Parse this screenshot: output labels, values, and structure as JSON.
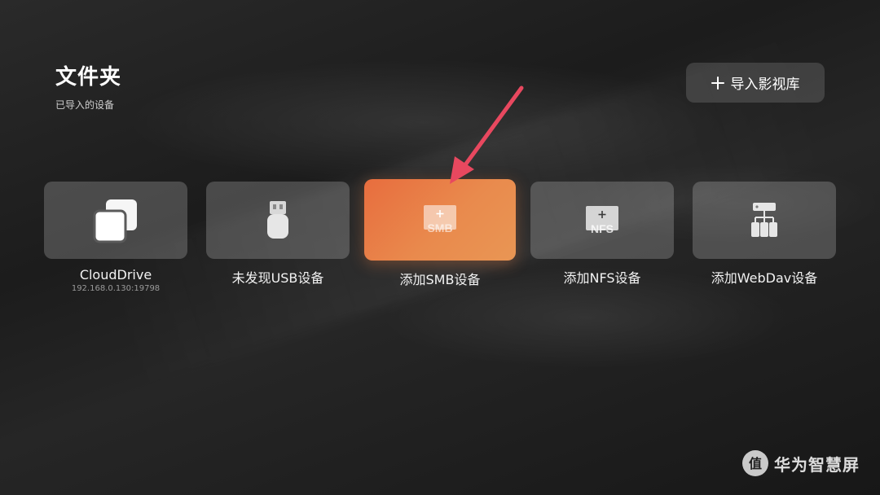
{
  "header": {
    "title": "文件夹",
    "subtitle": "已导入的设备"
  },
  "toolbar": {
    "import_label": "导入影视库"
  },
  "devices": [
    {
      "label": "CloudDrive",
      "address": "192.168.0.130:19798",
      "icon": "overlapping-squares-icon"
    },
    {
      "label": "未发现USB设备",
      "icon": "usb-drive-icon"
    },
    {
      "label": "添加SMB设备",
      "icon": "smb-add-icon",
      "icon_text": "SMB",
      "focused": true
    },
    {
      "label": "添加NFS设备",
      "icon": "nfs-add-icon",
      "icon_text": "NFS"
    },
    {
      "label": "添加WebDav设备",
      "icon": "webdav-network-icon"
    }
  ],
  "watermark": {
    "text": "华为智慧屏",
    "mark": "值"
  },
  "colors": {
    "focus_start": "#e86d3e",
    "focus_end": "#e99654",
    "arrow": "#e8485f"
  }
}
